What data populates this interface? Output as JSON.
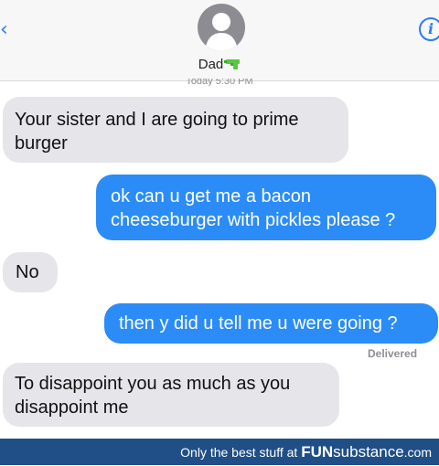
{
  "header": {
    "contact_name": "Dad",
    "timestamp": "Today 5:30 PM"
  },
  "messages": [
    {
      "type": "received",
      "text": "Your sister and I are going to prime burger"
    },
    {
      "type": "sent",
      "text": "ok can u get me a bacon cheeseburger with pickles please ?"
    },
    {
      "type": "received",
      "text": "No"
    },
    {
      "type": "sent",
      "text": "then y did u tell me u were going ?"
    },
    {
      "type": "received",
      "text": "To disappoint you as much as you disappoint me"
    }
  ],
  "status": {
    "delivered": "Delivered"
  },
  "footer": {
    "prefix": "Only the best stuff at ",
    "brand_bold": "FUN",
    "brand_rest": "substance",
    "domain": ".com"
  },
  "colors": {
    "sent_bubble": "#2b8cf7",
    "received_bubble": "#e5e5ea",
    "ios_blue": "#2f7bf5",
    "gun_emoji": "#58c840",
    "footer_bg": "#1f4f86"
  },
  "icons": [
    "back-chevron-icon",
    "avatar-icon",
    "water-gun-emoji-icon",
    "info-icon"
  ]
}
